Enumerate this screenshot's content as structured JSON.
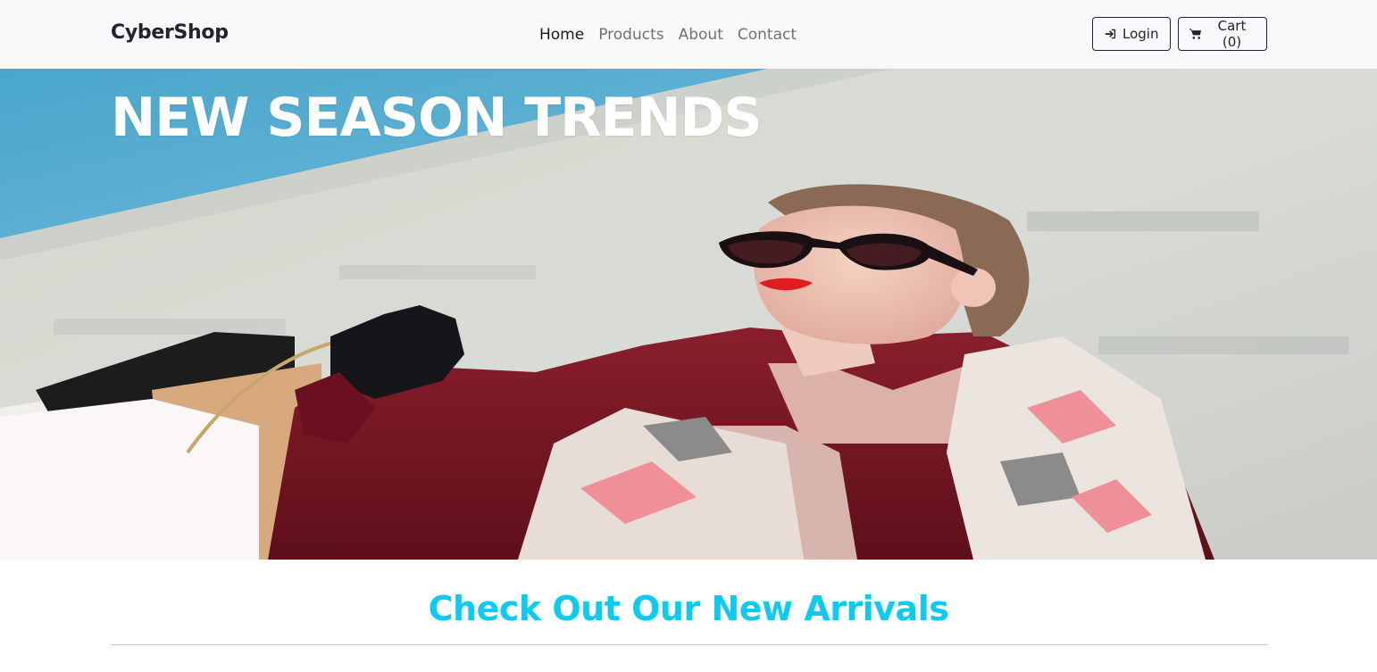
{
  "navbar": {
    "brand": "CyberShop",
    "links": [
      {
        "label": "Home",
        "active": true
      },
      {
        "label": "Products",
        "active": false
      },
      {
        "label": "About",
        "active": false
      },
      {
        "label": "Contact",
        "active": false
      }
    ],
    "login": {
      "label": "Login",
      "icon": "sign-in-icon"
    },
    "cart": {
      "label": "Cart (0)",
      "icon": "cart-icon"
    }
  },
  "hero": {
    "title": "NEW SEASON TRENDS"
  },
  "section": {
    "heading": "Check Out Our New Arrivals"
  },
  "colors": {
    "navbar_bg": "#f8f9fa",
    "accent_heading": "#0dcaf0",
    "hero_title": "#ffffff"
  }
}
